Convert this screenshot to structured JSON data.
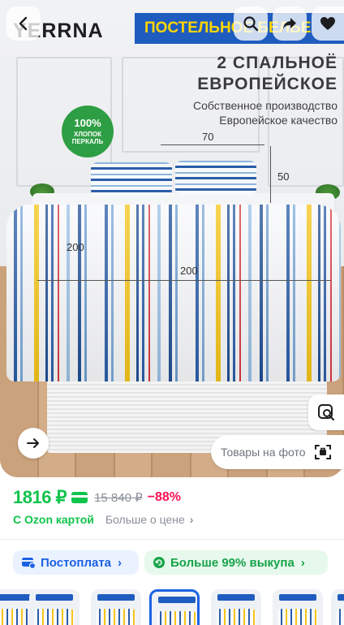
{
  "image": {
    "brand": "YERRNA",
    "banner": "ПОСТЕЛЬНОЕ БЕЛЬЕ",
    "title_line1": "2 СПАЛЬНОЁ",
    "title_line2": "ЕВРОПЕЙСКОЕ",
    "subtitle_line1": "Собственное производство",
    "subtitle_line2": "Европейское качество",
    "badge_percent": "100%",
    "badge_line2": "ХЛОПОК",
    "badge_line3": "ПЕРКАЛЬ",
    "dim_pillow_width": "70",
    "dim_pillow_height": "50",
    "dim_duvet_side": "200",
    "dim_duvet_width": "200",
    "photo_search_label": "Товары на фото"
  },
  "top_buttons": {
    "back_icon": "chevron-left-icon",
    "search_icon": "search-icon",
    "share_icon": "share-icon",
    "favorite_icon": "heart-icon"
  },
  "price": {
    "current": "1816 ₽",
    "old": "15 840 ₽",
    "discount": "−88%",
    "ozon_card_label": "С Ozon картой",
    "more_about_price": "Больше о цене"
  },
  "chips": {
    "postpay": "Постоплата",
    "buyout": "Больше 99% выкупа"
  },
  "colors": {
    "price_green": "#10c44c",
    "discount_pink": "#f91155",
    "accent_blue": "#1b61e4",
    "banner_blue": "#1f5cc0",
    "banner_yellow": "#ffd500"
  },
  "thumbnails_count": 6,
  "selected_thumbnail": 2
}
